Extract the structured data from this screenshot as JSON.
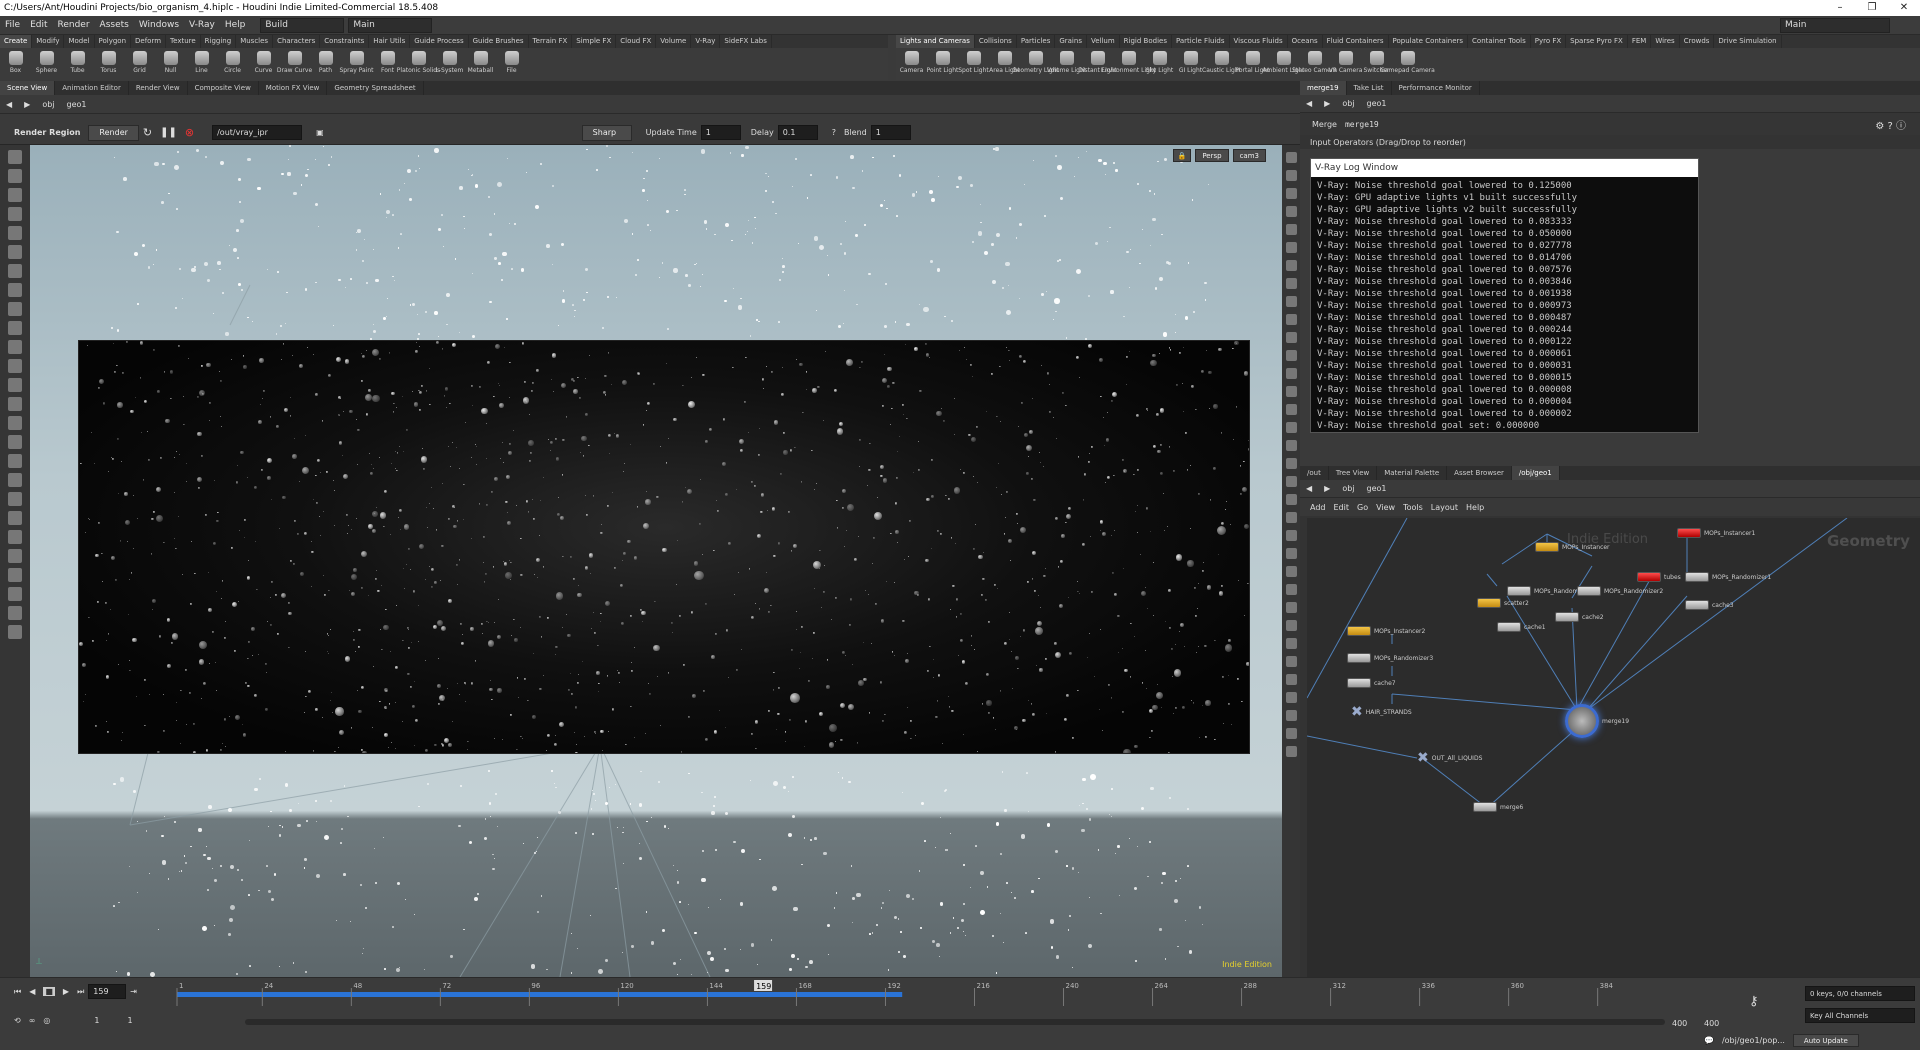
{
  "title": "C:/Users/Ant/Houdini Projects/bio_organism_4.hiplc - Houdini Indie Limited-Commercial 18.5.408",
  "window_controls": [
    "–",
    "❐",
    "✕"
  ],
  "menu": [
    "File",
    "Edit",
    "Render",
    "Assets",
    "Windows",
    "V-Ray",
    "Help"
  ],
  "desktop_build": "Build",
  "desktop_main": "Main",
  "desktop_main_right": "Main",
  "shelf_tabs_left": [
    "Create",
    "Modify",
    "Model",
    "Polygon",
    "Deform",
    "Texture",
    "Rigging",
    "Muscles",
    "Characters",
    "Constraints",
    "Hair Utils",
    "Guide Process",
    "Guide Brushes",
    "Terrain FX",
    "Simple FX",
    "Cloud FX",
    "Volume",
    "V-Ray",
    "SideFX Labs"
  ],
  "shelf_tabs_right": [
    "Lights and Cameras",
    "Collisions",
    "Particles",
    "Grains",
    "Vellum",
    "Rigid Bodies",
    "Particle Fluids",
    "Viscous Fluids",
    "Oceans",
    "Fluid Containers",
    "Populate Containers",
    "Container Tools",
    "Pyro FX",
    "Sparse Pyro FX",
    "FEM",
    "Wires",
    "Crowds",
    "Drive Simulation"
  ],
  "tools_left": [
    "Box",
    "Sphere",
    "Tube",
    "Torus",
    "Grid",
    "Null",
    "Line",
    "Circle",
    "Curve",
    "Draw Curve",
    "Path",
    "Spray Paint",
    "Font",
    "Platonic Solids",
    "L-System",
    "Metaball",
    "File"
  ],
  "tools_right": [
    "Camera",
    "Point Light",
    "Spot Light",
    "Area Light",
    "Geometry Light",
    "Volume Light",
    "Distant Light",
    "Environment Light",
    "Sky Light",
    "GI Light",
    "Caustic Light",
    "Portal Light",
    "Ambient Light",
    "Stereo Camera",
    "VR Camera",
    "Switcher",
    "Gamepad Camera"
  ],
  "left_pane_tabs": [
    "Scene View",
    "Animation Editor",
    "Render View",
    "Composite View",
    "Motion FX View",
    "Geometry Spreadsheet"
  ],
  "left_path": "obj",
  "left_path_node": "geo1",
  "render_region": "Render Region",
  "render_button": "Render",
  "rop_path": "/out/vray_ipr",
  "sharp": "Sharp",
  "update_time_label": "Update Time",
  "update_time_value": "1",
  "delay_label": "Delay",
  "delay_value": "0.1",
  "blend_label": "Blend",
  "blend_value": "1",
  "view_persp": "Persp",
  "view_cam": "cam3",
  "indie_edition": "Indie Edition",
  "param_pane_tabs": [
    "merge19",
    "Take List",
    "Performance Monitor"
  ],
  "param_path": "obj",
  "param_path_node": "geo1",
  "param_type": "Merge",
  "param_node_name": "merge19",
  "input_operators": "Input Operators (Drag/Drop to reorder)",
  "log_title": "V-Ray Log Window",
  "log_lines": [
    "V-Ray: Noise threshold goal lowered to 0.125000",
    "V-Ray: GPU adaptive lights v1 built successfully",
    "V-Ray: GPU adaptive lights v2 built successfully",
    "V-Ray: Noise threshold goal lowered to 0.083333",
    "V-Ray: Noise threshold goal lowered to 0.050000",
    "V-Ray: Noise threshold goal lowered to 0.027778",
    "V-Ray: Noise threshold goal lowered to 0.014706",
    "V-Ray: Noise threshold goal lowered to 0.007576",
    "V-Ray: Noise threshold goal lowered to 0.003846",
    "V-Ray: Noise threshold goal lowered to 0.001938",
    "V-Ray: Noise threshold goal lowered to 0.000973",
    "V-Ray: Noise threshold goal lowered to 0.000487",
    "V-Ray: Noise threshold goal lowered to 0.000244",
    "V-Ray: Noise threshold goal lowered to 0.000122",
    "V-Ray: Noise threshold goal lowered to 0.000061",
    "V-Ray: Noise threshold goal lowered to 0.000031",
    "V-Ray: Noise threshold goal lowered to 0.000015",
    "V-Ray: Noise threshold goal lowered to 0.000008",
    "V-Ray: Noise threshold goal lowered to 0.000004",
    "V-Ray: Noise threshold goal lowered to 0.000002",
    "V-Ray: Noise threshold goal set: 0.000000"
  ],
  "net_pane_tabs": [
    "/out",
    "Tree View",
    "Material Palette",
    "Asset Browser",
    "/obj/geo1"
  ],
  "net_path": "obj",
  "net_path_node": "geo1",
  "net_menu": [
    "Add",
    "Edit",
    "Go",
    "View",
    "Tools",
    "Layout",
    "Help"
  ],
  "net_watermark": "Indie Edition",
  "net_context": "Geometry",
  "nodes": {
    "n1": "MOPs_Instancer",
    "n2": "MOPs_Randomizer",
    "n3": "MOPs_Randomizer2",
    "n4": "scatter2",
    "n5": "cache1",
    "n6": "cache2",
    "n7": "MOPs_Instancer1",
    "n8": "tubes",
    "n9": "MOPs_Randomizer1",
    "n10": "cache3",
    "n11": "MOPs_Instancer2",
    "n12": "MOPs_Randomizer3",
    "n13": "cache7",
    "n14": "HAIR_STRANDS",
    "n15": "merge19",
    "n16": "OUT_All_LIQUIDS",
    "n17": "merge6"
  },
  "timeline": {
    "current_frame": "159",
    "ticks": [
      "1",
      "24",
      "48",
      "72",
      "96",
      "120",
      "144",
      "168",
      "192",
      "216",
      "240",
      "264",
      "288",
      "312",
      "336",
      "360",
      "384"
    ],
    "start": "1",
    "start2": "1",
    "end": "400",
    "end2": "400",
    "keys_info": "0 keys, 0/0 channels",
    "key_all": "Key All Channels",
    "status_path": "/obj/geo1/pop...",
    "auto_update": "Auto Update",
    "playback_fraction": 0.49
  }
}
